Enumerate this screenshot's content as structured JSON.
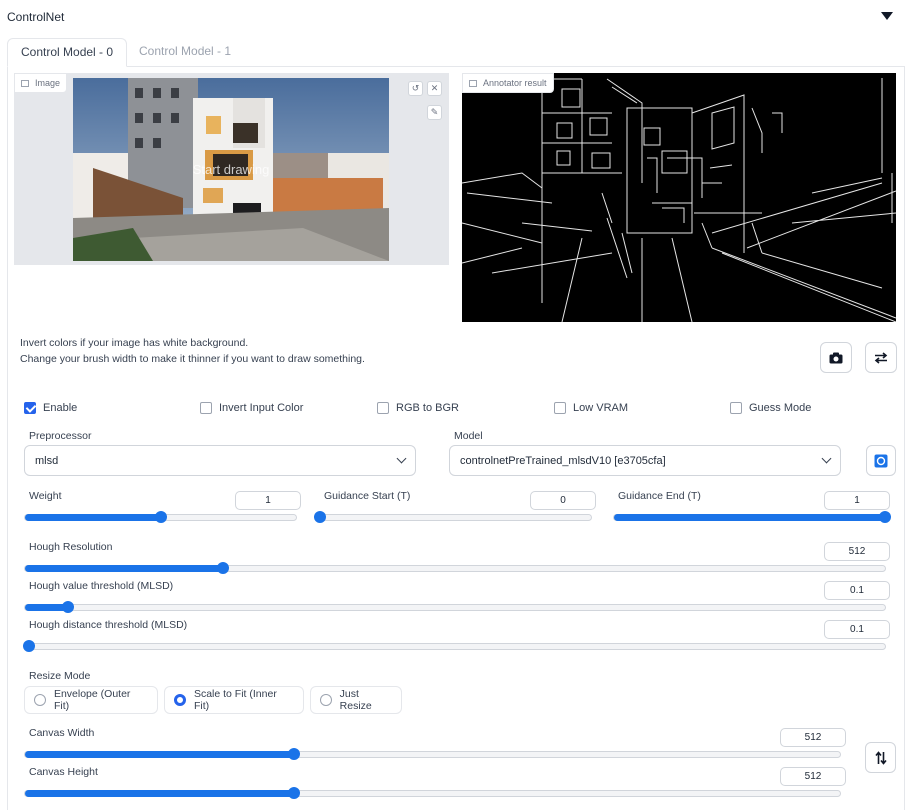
{
  "header": {
    "title": "ControlNet"
  },
  "tabs": [
    {
      "label": "Control Model - 0"
    },
    {
      "label": "Control Model - 1"
    }
  ],
  "image_block": {
    "label": "Image",
    "overlay_text": "Start drawing",
    "icon": "image-icon"
  },
  "annotator_block": {
    "label": "Annotator result",
    "icon": "image-icon"
  },
  "help": {
    "line1": "Invert colors if your image has white background.",
    "line2": "Change your brush width to make it thinner if you want to draw something."
  },
  "checkboxes": [
    {
      "label": "Enable",
      "checked": true
    },
    {
      "label": "Invert Input Color",
      "checked": false
    },
    {
      "label": "RGB to BGR",
      "checked": false
    },
    {
      "label": "Low VRAM",
      "checked": false
    },
    {
      "label": "Guess Mode",
      "checked": false
    }
  ],
  "preprocessor": {
    "label": "Preprocessor",
    "value": "mlsd"
  },
  "model": {
    "label": "Model",
    "value": "controlnetPreTrained_mlsdV10 [e3705cfa]"
  },
  "sliders": {
    "weight": {
      "label": "Weight",
      "value": "1",
      "fraction": 0.5
    },
    "guidance_start": {
      "label": "Guidance Start (T)",
      "value": "0",
      "fraction": 0.0
    },
    "guidance_end": {
      "label": "Guidance End (T)",
      "value": "1",
      "fraction": 1.0
    },
    "hough_resolution": {
      "label": "Hough Resolution",
      "value": "512",
      "fraction": 0.23
    },
    "hough_value": {
      "label": "Hough value threshold (MLSD)",
      "value": "0.1",
      "fraction": 0.05
    },
    "hough_distance": {
      "label": "Hough distance threshold (MLSD)",
      "value": "0.1",
      "fraction": 0.005
    },
    "canvas_width": {
      "label": "Canvas Width",
      "value": "512",
      "fraction": 0.33
    },
    "canvas_height": {
      "label": "Canvas Height",
      "value": "512",
      "fraction": 0.33
    }
  },
  "resize_mode": {
    "label": "Resize Mode",
    "options": [
      "Envelope (Outer Fit)",
      "Scale to Fit (Inner Fit)",
      "Just Resize"
    ],
    "selected": "Scale to Fit (Inner Fit)"
  },
  "colors": {
    "accent": "#1a73e8",
    "checkbox": "#2563eb"
  }
}
